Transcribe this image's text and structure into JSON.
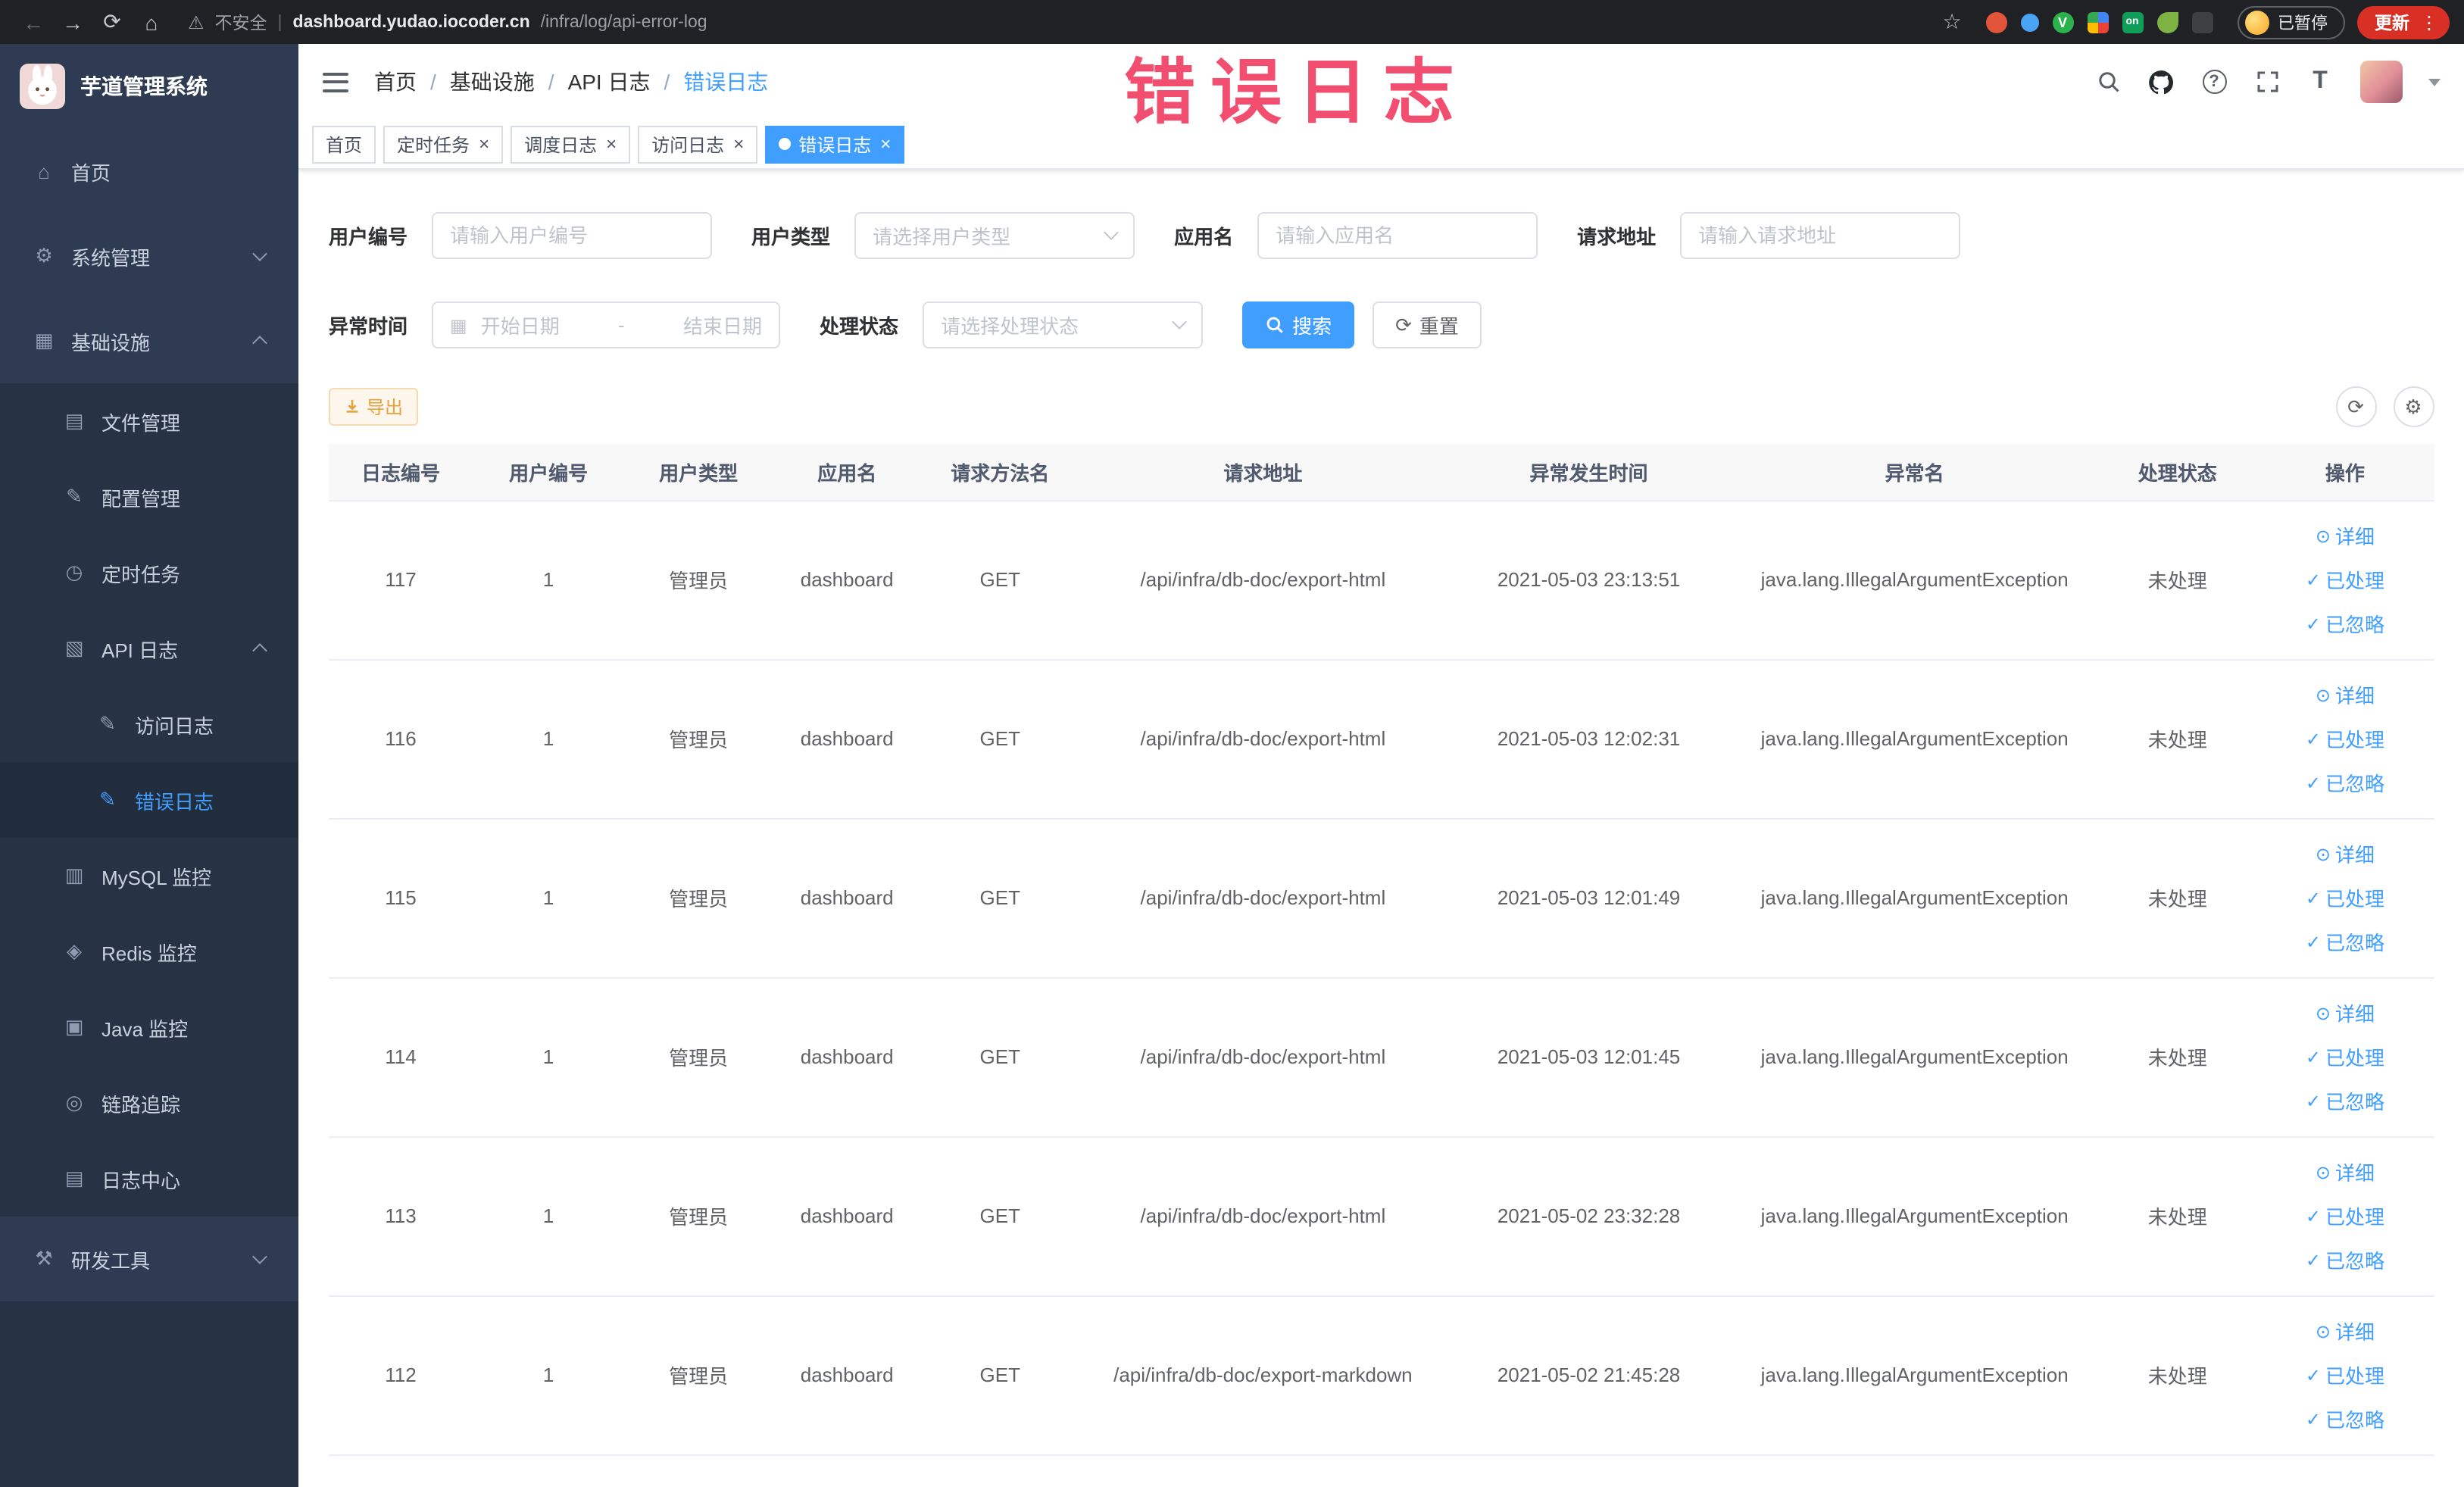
{
  "browser": {
    "security_label": "不安全",
    "url_domain": "dashboard.yudao.iocoder.cn",
    "url_path": "/infra/log/api-error-log",
    "paused_badge": "已暂停",
    "update_button": "更新",
    "ext_v_label": "V",
    "ext_on_label": "on"
  },
  "icons": {
    "back": "←",
    "forward": "→",
    "reload": "⟳",
    "home": "⌂",
    "warning": "⚠",
    "star": "☆",
    "divider": "|",
    "menu_dots": "⋮",
    "help": "?",
    "font_size": "T",
    "calendar": "▦",
    "refresh": "⟳",
    "gear": "⚙",
    "close": "×",
    "slash": "/"
  },
  "annotation": {
    "text": "错误日志"
  },
  "sidebar": {
    "app_title": "芋道管理系统",
    "items": [
      {
        "name": "home",
        "label": "首页",
        "glyph": "⌂",
        "level": 0
      },
      {
        "name": "system-mgmt",
        "label": "系统管理",
        "glyph": "⚙",
        "level": 0,
        "arrow": "down"
      },
      {
        "name": "infrastructure",
        "label": "基础设施",
        "glyph": "▦",
        "level": 0,
        "arrow": "up"
      },
      {
        "name": "file-mgmt",
        "label": "文件管理",
        "glyph": "▤",
        "level": 1
      },
      {
        "name": "config-mgmt",
        "label": "配置管理",
        "glyph": "✎",
        "level": 1
      },
      {
        "name": "cron-job",
        "label": "定时任务",
        "glyph": "◷",
        "level": 1
      },
      {
        "name": "api-log",
        "label": "API 日志",
        "glyph": "▧",
        "level": 1,
        "arrow": "up"
      },
      {
        "name": "access-log",
        "label": "访问日志",
        "glyph": "✎",
        "level": 2
      },
      {
        "name": "error-log",
        "label": "错误日志",
        "glyph": "✎",
        "level": 2,
        "active": true
      },
      {
        "name": "mysql-monitor",
        "label": "MySQL 监控",
        "glyph": "▥",
        "level": 1
      },
      {
        "name": "redis-monitor",
        "label": "Redis 监控",
        "glyph": "◈",
        "level": 1
      },
      {
        "name": "java-monitor",
        "label": "Java 监控",
        "glyph": "▣",
        "level": 1
      },
      {
        "name": "tracing",
        "label": "链路追踪",
        "glyph": "◎",
        "level": 1
      },
      {
        "name": "log-center",
        "label": "日志中心",
        "glyph": "▤",
        "level": 1
      },
      {
        "name": "dev-tools",
        "label": "研发工具",
        "glyph": "⚒",
        "level": 0,
        "arrow": "down"
      }
    ]
  },
  "header": {
    "breadcrumb": [
      "首页",
      "基础设施",
      "API 日志",
      "错误日志"
    ]
  },
  "tags": [
    {
      "name": "home",
      "label": "首页",
      "closable": false,
      "active": false
    },
    {
      "name": "cron-job",
      "label": "定时任务",
      "closable": true,
      "active": false
    },
    {
      "name": "job-log",
      "label": "调度日志",
      "closable": true,
      "active": false
    },
    {
      "name": "access-log",
      "label": "访问日志",
      "closable": true,
      "active": false
    },
    {
      "name": "error-log",
      "label": "错误日志",
      "closable": true,
      "active": true
    }
  ],
  "filters": {
    "user_id": {
      "label": "用户编号",
      "placeholder": "请输入用户编号"
    },
    "user_type": {
      "label": "用户类型",
      "placeholder": "请选择用户类型"
    },
    "app_name": {
      "label": "应用名",
      "placeholder": "请输入应用名"
    },
    "request_url": {
      "label": "请求地址",
      "placeholder": "请输入请求地址"
    },
    "exception_time": {
      "label": "异常时间",
      "start_placeholder": "开始日期",
      "separator": "-",
      "end_placeholder": "结束日期"
    },
    "process_status": {
      "label": "处理状态",
      "placeholder": "请选择处理状态"
    },
    "search_button": "搜索",
    "reset_button": "重置"
  },
  "toolbar": {
    "export_label": "导出"
  },
  "table": {
    "columns": [
      "日志编号",
      "用户编号",
      "用户类型",
      "应用名",
      "请求方法名",
      "请求地址",
      "异常发生时间",
      "异常名",
      "处理状态",
      "操作"
    ],
    "column_keys": [
      "log-id",
      "user-id",
      "user-type",
      "app-name",
      "method",
      "url",
      "time",
      "exception",
      "status"
    ],
    "rows": [
      [
        "117",
        "1",
        "管理员",
        "dashboard",
        "GET",
        "/api/infra/db-doc/export-html",
        "2021-05-03 23:13:51",
        "java.lang.IllegalArgumentException",
        "未处理"
      ],
      [
        "116",
        "1",
        "管理员",
        "dashboard",
        "GET",
        "/api/infra/db-doc/export-html",
        "2021-05-03 12:02:31",
        "java.lang.IllegalArgumentException",
        "未处理"
      ],
      [
        "115",
        "1",
        "管理员",
        "dashboard",
        "GET",
        "/api/infra/db-doc/export-html",
        "2021-05-03 12:01:49",
        "java.lang.IllegalArgumentException",
        "未处理"
      ],
      [
        "114",
        "1",
        "管理员",
        "dashboard",
        "GET",
        "/api/infra/db-doc/export-html",
        "2021-05-03 12:01:45",
        "java.lang.IllegalArgumentException",
        "未处理"
      ],
      [
        "113",
        "1",
        "管理员",
        "dashboard",
        "GET",
        "/api/infra/db-doc/export-html",
        "2021-05-02 23:32:28",
        "java.lang.IllegalArgumentException",
        "未处理"
      ],
      [
        "112",
        "1",
        "管理员",
        "dashboard",
        "GET",
        "/api/infra/db-doc/export-markdown",
        "2021-05-02 21:45:28",
        "java.lang.IllegalArgumentException",
        "未处理"
      ]
    ],
    "row_actions": [
      {
        "name": "detail-link",
        "label": "详细",
        "glyph": "⊙",
        "icon": "eye"
      },
      {
        "name": "processed-link",
        "label": "已处理",
        "glyph": "✓",
        "icon": "check"
      },
      {
        "name": "ignored-link",
        "label": "已忽略",
        "glyph": "✓",
        "icon": "check"
      }
    ]
  }
}
